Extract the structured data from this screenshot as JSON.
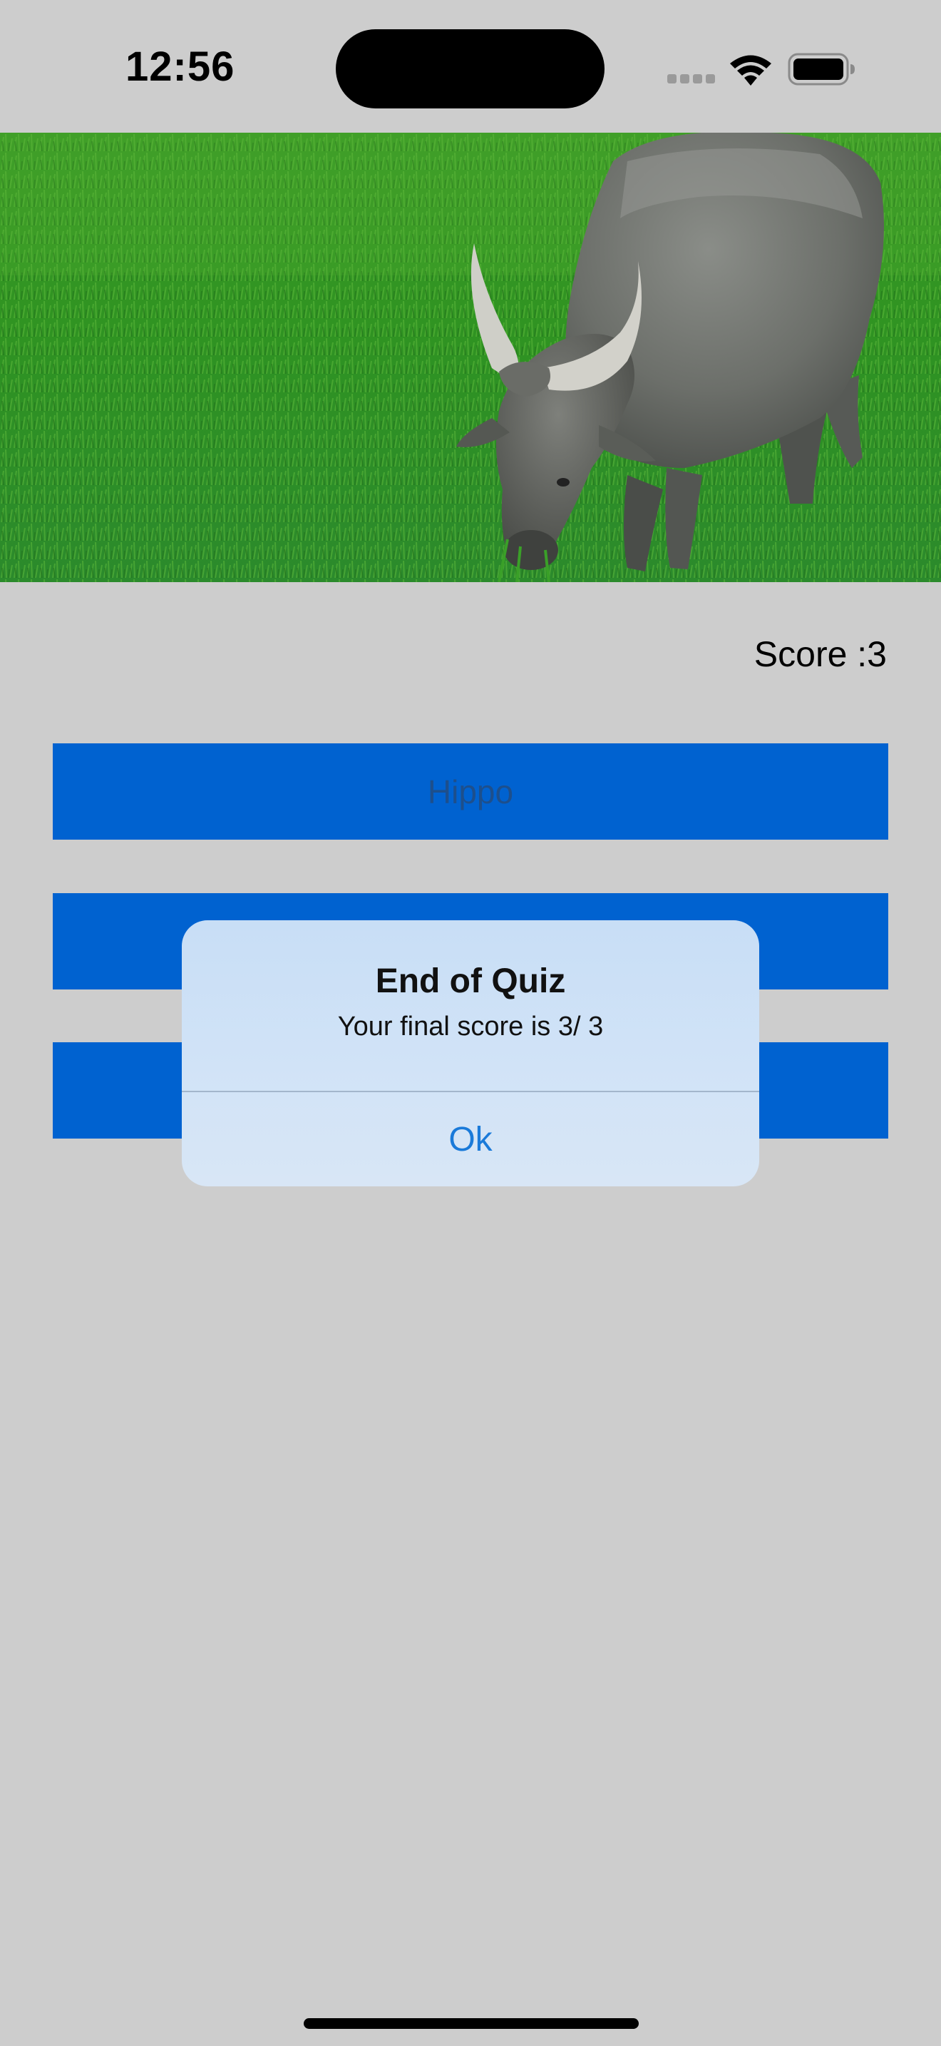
{
  "status_bar": {
    "time": "12:56",
    "icons": [
      "signal-icon",
      "wifi-icon",
      "battery-icon"
    ]
  },
  "hero": {
    "subject": "water buffalo grazing on grass"
  },
  "quiz": {
    "score_text": "Score :3",
    "answers": [
      {
        "label": "Hippo"
      },
      {
        "label": ""
      },
      {
        "label": ""
      }
    ]
  },
  "alert": {
    "title": "End of Quiz",
    "message": "Your final score is 3/ 3",
    "ok_label": "Ok"
  },
  "colors": {
    "background": "#cdcdcd",
    "button": "#0062d0",
    "alert_tint": "#d1e3f7",
    "link": "#1a7ad9"
  }
}
